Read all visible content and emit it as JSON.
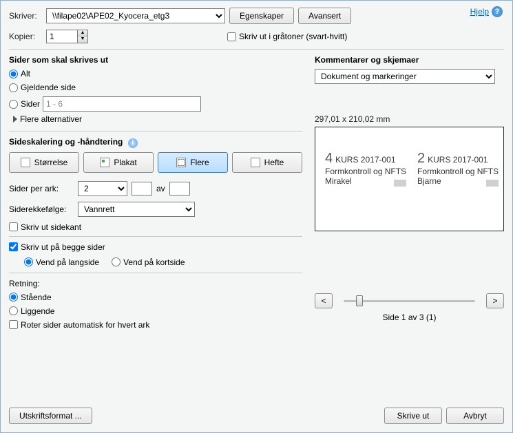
{
  "top": {
    "printer_label": "Skriver:",
    "printer_value": "\\\\filape02\\APE02_Kyocera_etg3",
    "properties_btn": "Egenskaper",
    "advanced_btn": "Avansert",
    "copies_label": "Kopier:",
    "copies_value": "1",
    "grayscale_label": "Skriv ut i gråtoner (svart-hvitt)"
  },
  "help": {
    "label": "Hjelp"
  },
  "pages": {
    "header": "Sider som skal skrives ut",
    "all": "Alt",
    "current": "Gjeldende side",
    "range": "Sider",
    "range_value": "1 - 6",
    "more": "Flere alternativer"
  },
  "scaling": {
    "header": "Sideskalering og -håndtering",
    "size": "Størrelse",
    "poster": "Plakat",
    "multi": "Flere",
    "booklet": "Hefte",
    "pps_label": "Sider per ark:",
    "pps_value": "2",
    "of": "av",
    "order_label": "Siderekkefølge:",
    "order_value": "Vannrett",
    "border": "Skriv ut sidekant"
  },
  "duplex": {
    "both": "Skriv ut på begge sider",
    "long": "Vend på langside",
    "short": "Vend på kortside"
  },
  "orient": {
    "label": "Retning:",
    "portrait": "Stående",
    "landscape": "Liggende",
    "autorotate": "Roter sider automatisk for hvert ark"
  },
  "comments": {
    "header": "Kommentarer og skjemaer",
    "value": "Dokument og markeringer"
  },
  "preview": {
    "dims": "297,01 x 210,02 mm",
    "left_num": "4",
    "right_num": "2",
    "course": "KURS 2017-001",
    "line2": "Formkontroll og NFTS",
    "name_left": "Mirakel",
    "name_right": "Bjarne",
    "page_of": "Side 1 av 3 (1)",
    "prev": "<",
    "next": ">"
  },
  "footer": {
    "page_setup": "Utskriftsformat ...",
    "print": "Skrive ut",
    "cancel": "Avbryt"
  }
}
